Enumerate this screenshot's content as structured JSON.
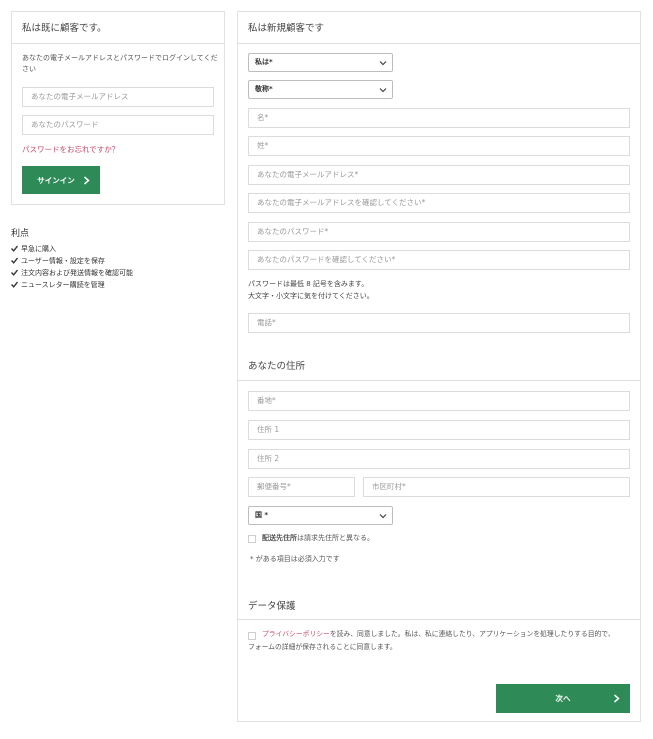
{
  "login": {
    "heading": "私は既に顧客です。",
    "intro": "あなたの電子メールアドレスとパスワードでログインしてください",
    "email_placeholder": "あなたの電子メールアドレス",
    "password_placeholder": "あなたのパスワード",
    "forgot_link": "パスワードをお忘れですか？",
    "signin_label": "サインイン"
  },
  "benefits": {
    "heading": "利点",
    "items": [
      "早急に購入",
      "ユーザー情報・設定を保存",
      "注文内容および発送情報を確認可能",
      "ニュースレター購読を管理"
    ]
  },
  "register": {
    "heading": "私は新規顧客です",
    "title_select": "私は*",
    "honorific_select": "敬称*",
    "first_name": "名*",
    "last_name": "姓*",
    "email": "あなたの電子メールアドレス*",
    "email_confirm": "あなたの電子メールアドレスを確認してください*",
    "password": "あなたのパスワード*",
    "password_confirm": "あなたのパスワードを確認してください*",
    "password_hint_1": "パスワードは最低 8 記号を含みます。",
    "password_hint_2": "大文字・小文字に気を付けてください。",
    "phone": "電話*"
  },
  "address": {
    "heading": "あなたの住所",
    "street": "番地*",
    "address1": "住所 1",
    "address2": "住所 2",
    "zip": "郵便番号*",
    "city": "市区町村*",
    "country_select": "国 *",
    "shipping_bold": "配送先住所",
    "shipping_rest": "は請求先住所と異なる。",
    "required_note": "* がある項目は必須入力です"
  },
  "privacy": {
    "heading": "データ保護",
    "link": "プライバシーポリシー",
    "text_1": "を読み、同意しました。私は、私に連絡したり、アプリケーションを処理したりする目的で、",
    "text_2": "フォームの詳細が保存されることに同意します。"
  },
  "next_label": "次へ",
  "colors": {
    "accent_green": "#2e8b57",
    "link_pink": "#c0506a",
    "border": "#e1e1e1"
  }
}
